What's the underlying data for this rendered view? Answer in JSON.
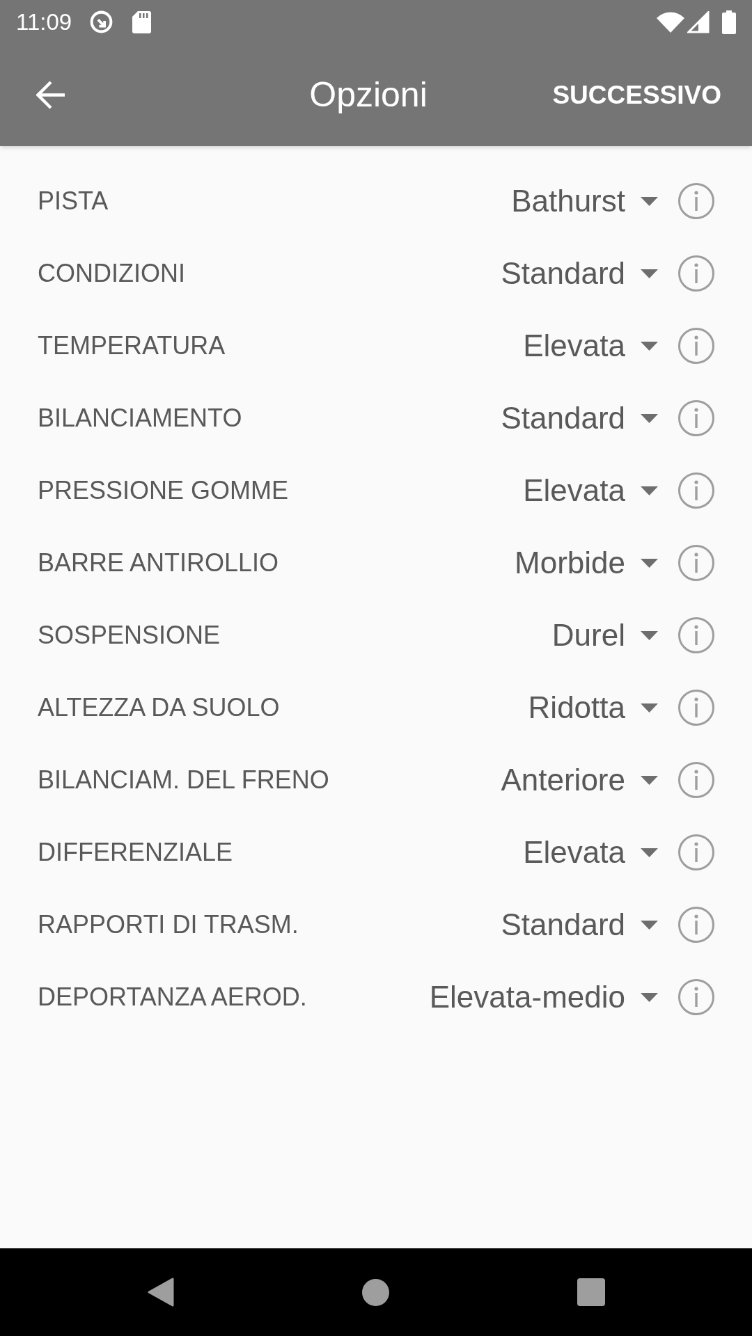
{
  "status_bar": {
    "time": "11:09"
  },
  "app_bar": {
    "title": "Opzioni",
    "action": "SUCCESSIVO"
  },
  "options": [
    {
      "label": "PISTA",
      "value": "Bathurst"
    },
    {
      "label": "CONDIZIONI",
      "value": "Standard"
    },
    {
      "label": "TEMPERATURA",
      "value": "Elevata"
    },
    {
      "label": "BILANCIAMENTO",
      "value": "Standard"
    },
    {
      "label": "PRESSIONE GOMME",
      "value": "Elevata"
    },
    {
      "label": "BARRE ANTIROLLIO",
      "value": "Morbide"
    },
    {
      "label": "SOSPENSIONE",
      "value": "Durel"
    },
    {
      "label": "ALTEZZA DA SUOLO",
      "value": "Ridotta"
    },
    {
      "label": "BILANCIAM. DEL FRENO",
      "value": "Anteriore"
    },
    {
      "label": "DIFFERENZIALE",
      "value": "Elevata"
    },
    {
      "label": "RAPPORTI DI TRASM.",
      "value": "Standard"
    },
    {
      "label": "DEPORTANZA AEROD.",
      "value": "Elevata-medio"
    }
  ]
}
